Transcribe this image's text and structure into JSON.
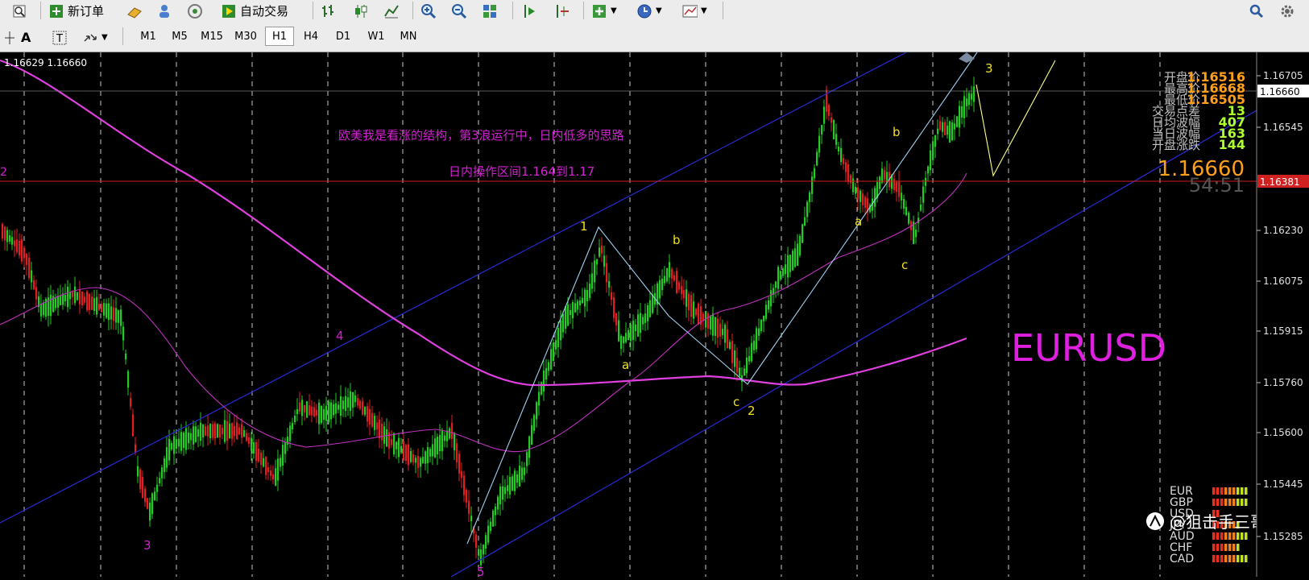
{
  "toolbar": {
    "new_order_label": "新订单",
    "auto_trade_label": "自动交易"
  },
  "timeframes": [
    "M1",
    "M5",
    "M15",
    "M30",
    "H1",
    "H4",
    "D1",
    "W1",
    "MN"
  ],
  "active_timeframe": "H1",
  "chart": {
    "quote_line": "1.16629 1.16660",
    "symbol": "EURUSD",
    "annotation_1": "欧美我是看涨的结构，第3浪运行中，日内低多的思路",
    "annotation_2": "日内操作区间1.164到1.17",
    "left_edge_label": "2",
    "current_price_label": "1.16660",
    "red_line_price_label": "1.16381",
    "price_axis": [
      "1.16705",
      "1.16545",
      "1.16230",
      "1.16075",
      "1.15915",
      "1.15760",
      "1.15600",
      "1.15445",
      "1.15285"
    ],
    "wave_labels": {
      "w1": "1",
      "w2": "2",
      "w3": "3",
      "w4": "4",
      "w5": "5",
      "w3b": "3",
      "a1": "a",
      "b1": "b",
      "c1": "c",
      "a2": "a",
      "b2": "b",
      "c2": "c"
    }
  },
  "info_panel": {
    "rows": [
      {
        "label": "开盘价",
        "value": "1.16516"
      },
      {
        "label": "最高价",
        "value": "1.16668"
      },
      {
        "label": "最低价",
        "value": "1.16505"
      },
      {
        "label": "交易点差",
        "value": "13"
      },
      {
        "label": "日均波幅",
        "value": "407"
      },
      {
        "label": "当日波幅",
        "value": "163"
      },
      {
        "label": "开盘涨跌",
        "value": "144"
      }
    ],
    "big_price": "1.16660",
    "countdown": "54:51"
  },
  "strength_meter": {
    "currencies": [
      "EUR",
      "GBP",
      "USD",
      "JPY",
      "AUD",
      "CHF",
      "CAD"
    ]
  },
  "watermark": "@狙击手三哥",
  "colors": {
    "bull": "#22cc22",
    "bear": "#e02020",
    "ma_long": "#e040e0",
    "channel": "#2a2ad8",
    "wave_line": "#9fd0f0",
    "annot": "#d020d0",
    "price_value": "#ff9f1a",
    "price_value_green": "#adff2f"
  }
}
